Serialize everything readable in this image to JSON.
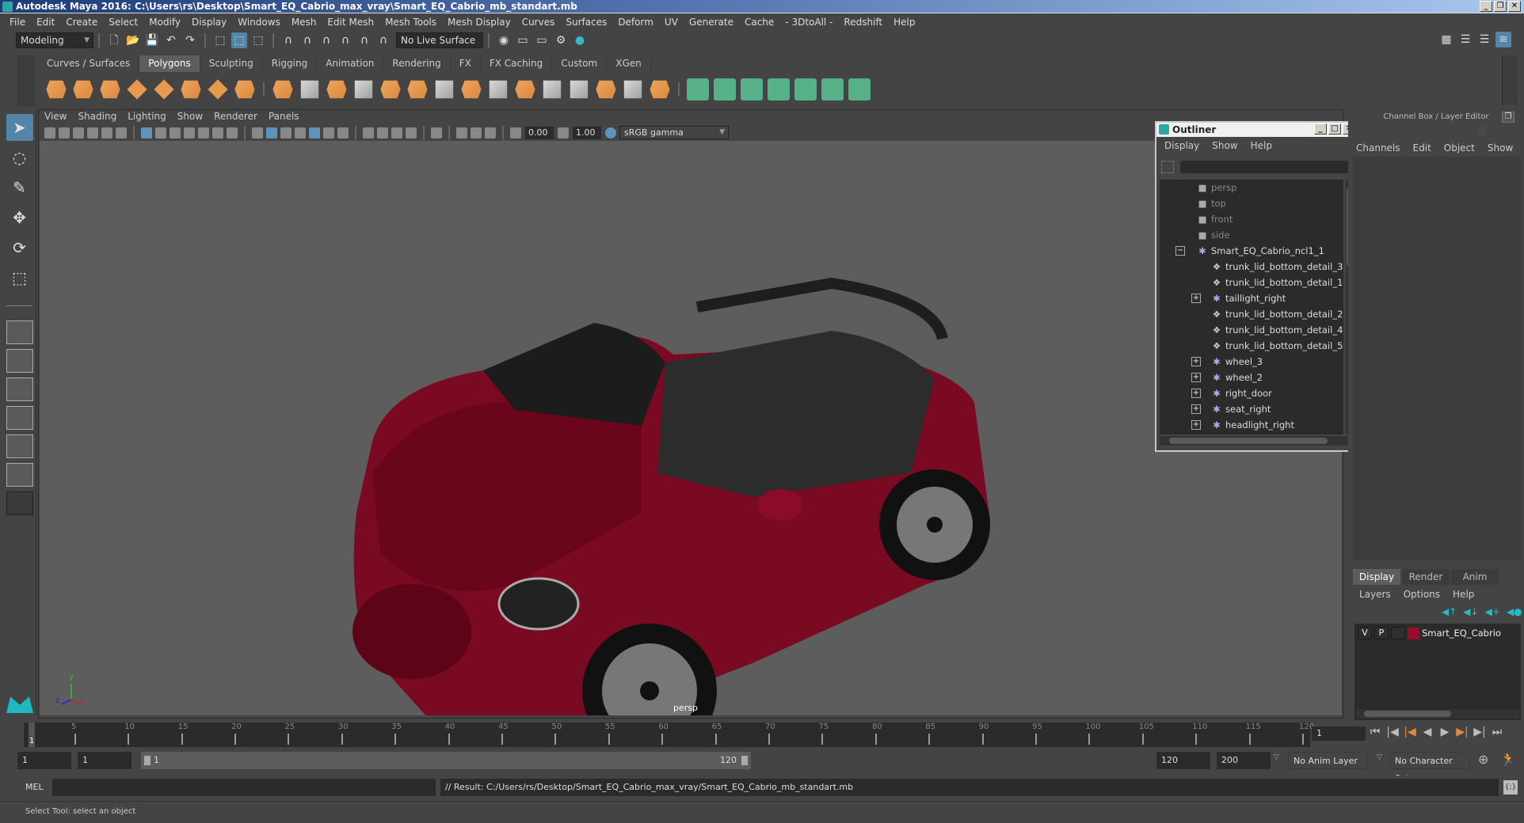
{
  "window": {
    "title": "Autodesk Maya 2016: C:\\Users\\rs\\Desktop\\Smart_EQ_Cabrio_max_vray\\Smart_EQ_Cabrio_mb_standart.mb",
    "buttons": [
      "_",
      "❐",
      "✕"
    ]
  },
  "menubar": [
    "File",
    "Edit",
    "Create",
    "Select",
    "Modify",
    "Display",
    "Windows",
    "Mesh",
    "Edit Mesh",
    "Mesh Tools",
    "Mesh Display",
    "Curves",
    "Surfaces",
    "Deform",
    "UV",
    "Generate",
    "Cache",
    "- 3DtoAll -",
    "Redshift",
    "Help"
  ],
  "statusline": {
    "mode": "Modeling",
    "live_surface": "No Live Surface"
  },
  "shelf": {
    "tabs": [
      "Curves / Surfaces",
      "Polygons",
      "Sculpting",
      "Rigging",
      "Animation",
      "Rendering",
      "FX",
      "FX Caching",
      "Custom",
      "XGen"
    ],
    "active_tab": "Polygons"
  },
  "viewport": {
    "menu": [
      "View",
      "Shading",
      "Lighting",
      "Show",
      "Renderer",
      "Panels"
    ],
    "exposure": "0.00",
    "gamma": "1.00",
    "color_space": "sRGB gamma",
    "camera_label": "persp",
    "axis": {
      "x": "x",
      "y": "y",
      "z": "z"
    },
    "model_color": "#7a0a22"
  },
  "outliner": {
    "title": "Outliner",
    "menu": [
      "Display",
      "Show",
      "Help"
    ],
    "items": [
      {
        "label": "persp",
        "type": "camera",
        "depth": 0
      },
      {
        "label": "top",
        "type": "camera",
        "depth": 0
      },
      {
        "label": "front",
        "type": "camera",
        "depth": 0
      },
      {
        "label": "side",
        "type": "camera",
        "depth": 0
      },
      {
        "label": "Smart_EQ_Cabrio_ncl1_1",
        "type": "group",
        "expander": "−",
        "depth": 0
      },
      {
        "label": "trunk_lid_bottom_detail_3",
        "type": "mesh",
        "depth": 1
      },
      {
        "label": "trunk_lid_bottom_detail_1",
        "type": "mesh",
        "depth": 1
      },
      {
        "label": "taillight_right",
        "type": "group",
        "expander": "+",
        "depth": 1
      },
      {
        "label": "trunk_lid_bottom_detail_2",
        "type": "mesh",
        "depth": 1
      },
      {
        "label": "trunk_lid_bottom_detail_4",
        "type": "mesh",
        "depth": 1
      },
      {
        "label": "trunk_lid_bottom_detail_5",
        "type": "mesh",
        "depth": 1
      },
      {
        "label": "wheel_3",
        "type": "group",
        "expander": "+",
        "depth": 1
      },
      {
        "label": "wheel_2",
        "type": "group",
        "expander": "+",
        "depth": 1
      },
      {
        "label": "right_door",
        "type": "group",
        "expander": "+",
        "depth": 1
      },
      {
        "label": "seat_right",
        "type": "group",
        "expander": "+",
        "depth": 1
      },
      {
        "label": "headlight_right",
        "type": "group",
        "expander": "+",
        "depth": 1
      }
    ]
  },
  "channel_box": {
    "title": "Channel Box / Layer Editor",
    "menu": [
      "Channels",
      "Edit",
      "Object",
      "Show"
    ]
  },
  "layer_editor": {
    "tabs": [
      "Display",
      "Render",
      "Anim"
    ],
    "active_tab": "Display",
    "menu": [
      "Layers",
      "Options",
      "Help"
    ],
    "layers": [
      {
        "v": "V",
        "p": "P",
        "color": "#9b0a2a",
        "name": "Smart_EQ_Cabrio"
      }
    ]
  },
  "timeline": {
    "ticks": [
      5,
      10,
      15,
      20,
      25,
      30,
      35,
      40,
      45,
      50,
      55,
      60,
      65,
      70,
      75,
      80,
      85,
      90,
      95,
      100,
      105,
      110,
      115,
      120
    ],
    "start": 1,
    "end": 120,
    "current_frame_marker": "1",
    "current_frame": "1"
  },
  "range": {
    "start": "1",
    "playback_start": "1",
    "slider_start": "1",
    "slider_end": "120",
    "playback_end": "120",
    "end": "200",
    "anim_layer": "No Anim Layer",
    "character_set": "No Character Set"
  },
  "command_line": {
    "language": "MEL",
    "input": "",
    "result": "// Result: C:/Users/rs/Desktop/Smart_EQ_Cabrio_max_vray/Smart_EQ_Cabrio_mb_standart.mb"
  },
  "helpline": "Select Tool: select an object"
}
